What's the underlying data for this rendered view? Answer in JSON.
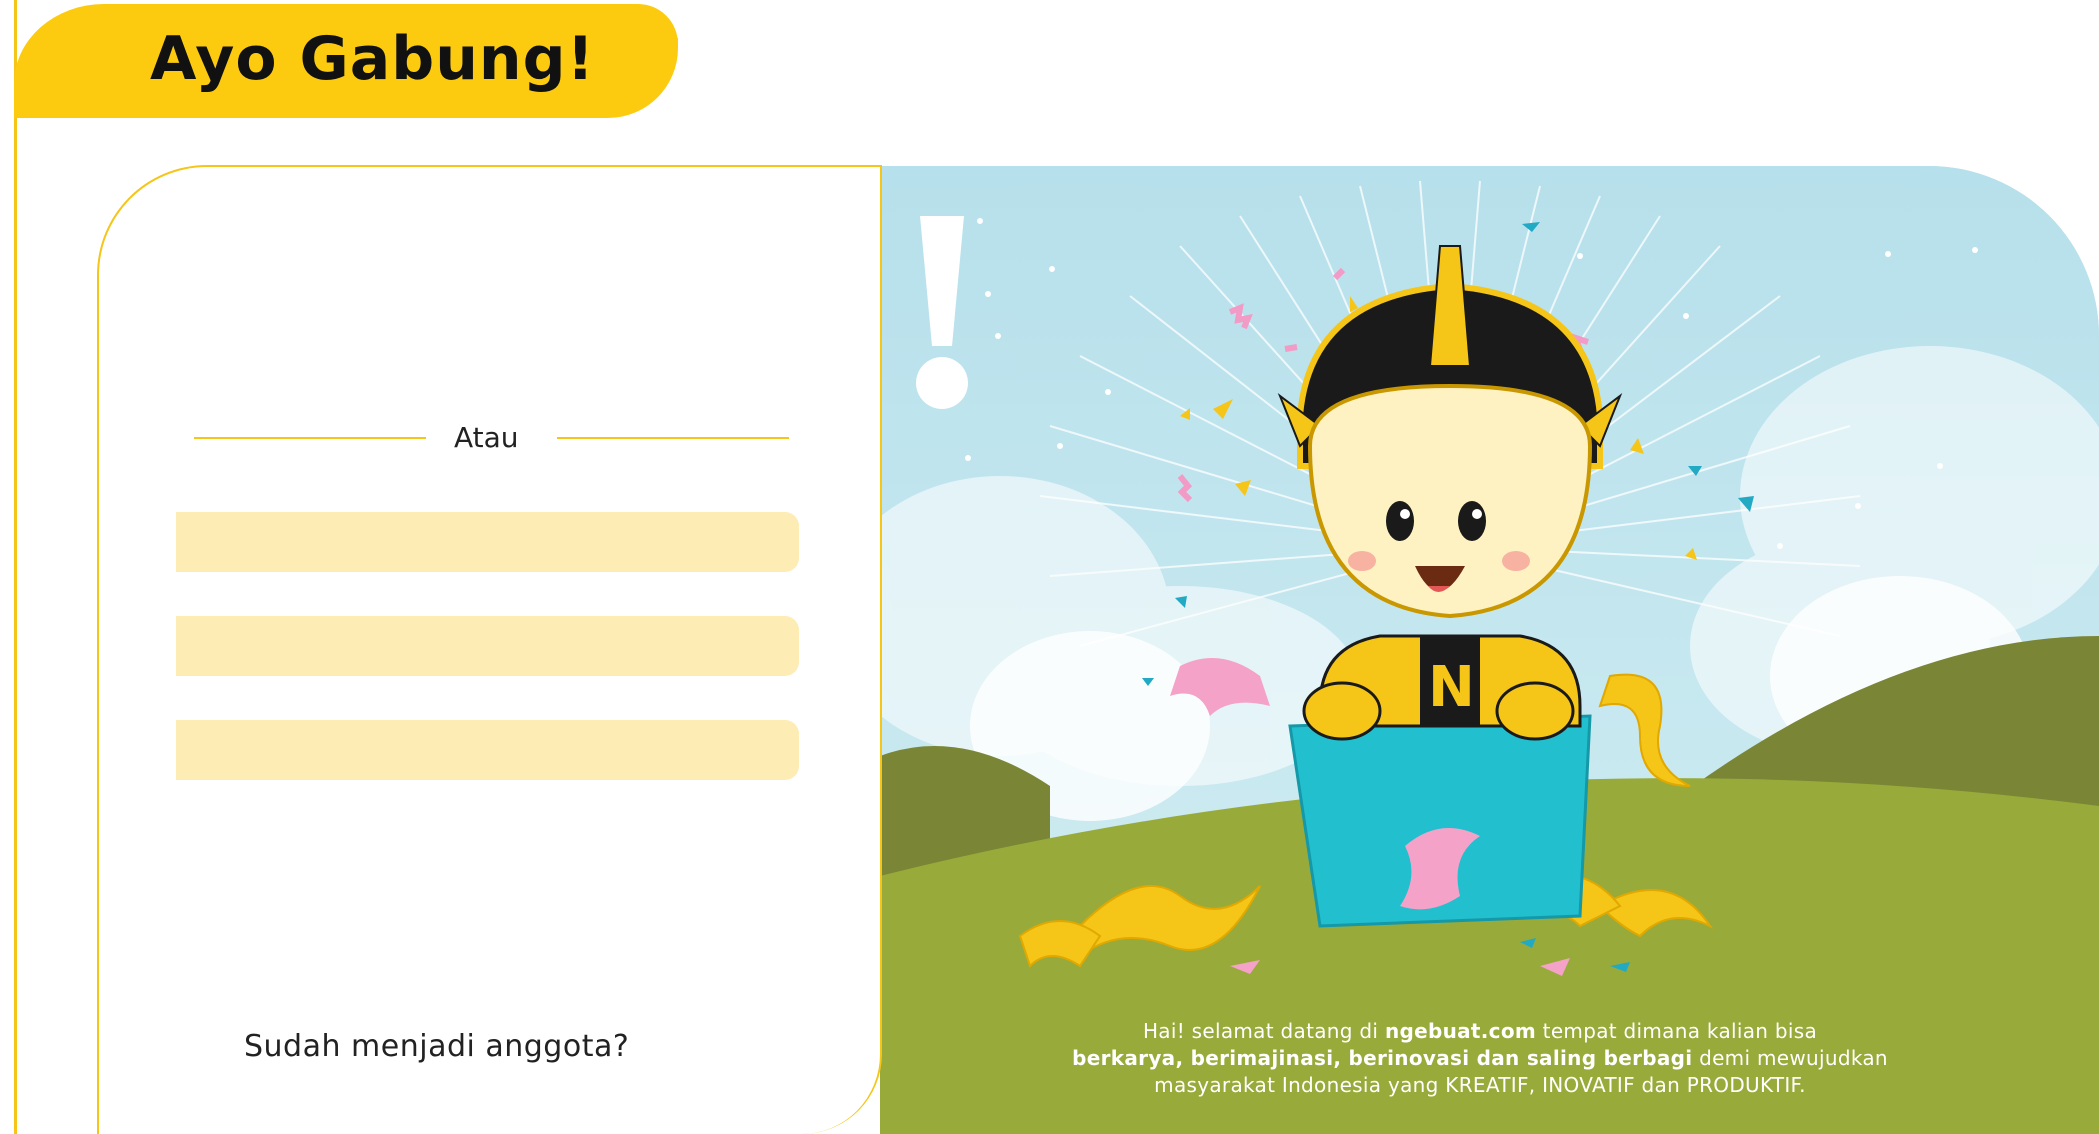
{
  "header": {
    "title": "Ayo Gabung!"
  },
  "form": {
    "divider_text": "Atau",
    "fields": [
      {
        "placeholder": ""
      },
      {
        "placeholder": ""
      },
      {
        "placeholder": ""
      }
    ],
    "member_prompt": "Sudah menjadi anggota?"
  },
  "welcome": {
    "line1_prefix": "Hai! selamat datang di ",
    "line1_site": "ngebuat.com",
    "line1_suffix": " tempat dimana kalian bisa",
    "line2_bold": "berkarya, berimajinasi, berinovasi dan saling berbagi",
    "line2_suffix": " demi mewujudkan",
    "line3": "masyarakat Indonesia yang KREATIF, INOVATIF dan PRODUKTIF."
  },
  "colors": {
    "brand_yellow": "#fccb0f",
    "field_fill": "#feecb5",
    "sky": "#b8e0ea",
    "grass": "#98ab3a",
    "box": "#22bfcf"
  }
}
